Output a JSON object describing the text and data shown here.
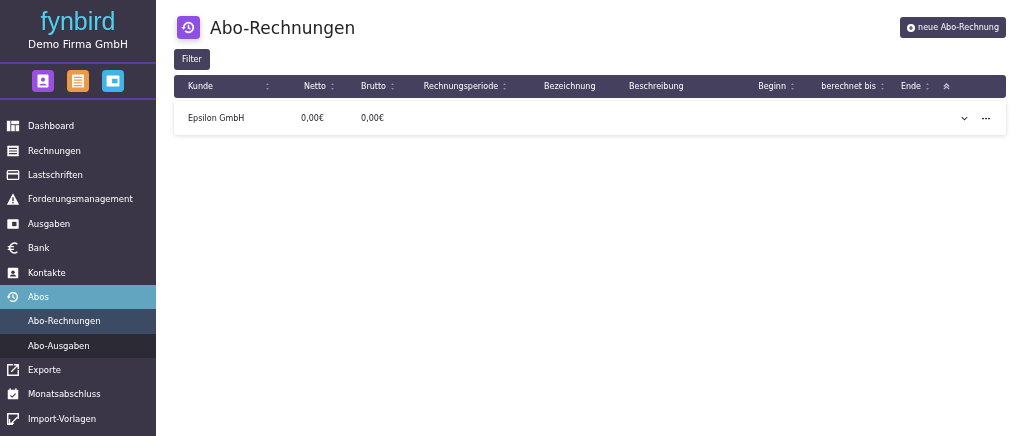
{
  "brand": {
    "logo": "fynbird",
    "company": "Demo Firma GmbH"
  },
  "sidebar": {
    "items": [
      {
        "label": "Dashboard",
        "selected": false
      },
      {
        "label": "Rechnungen",
        "selected": false
      },
      {
        "label": "Lastschriften",
        "selected": false
      },
      {
        "label": "Forderungsmanagement",
        "selected": false
      },
      {
        "label": "Ausgaben",
        "selected": false
      },
      {
        "label": "Bank",
        "selected": false
      },
      {
        "label": "Kontakte",
        "selected": false
      },
      {
        "label": "Abos",
        "selected": true,
        "expanded": true,
        "children": [
          {
            "label": "Abo-Rechnungen",
            "selected": true
          },
          {
            "label": "Abo-Ausgaben",
            "selected": false
          }
        ]
      },
      {
        "label": "Exporte",
        "selected": false
      },
      {
        "label": "Monatsabschluss",
        "selected": false
      },
      {
        "label": "Import-Vorlagen",
        "selected": false
      }
    ]
  },
  "page": {
    "title": "Abo-Rechnungen",
    "new_button": "neue Abo-Rechnung",
    "filter_button": "Filter"
  },
  "table": {
    "columns": [
      {
        "label": "Kunde",
        "sortable": true
      },
      {
        "label": "Netto",
        "sortable": true
      },
      {
        "label": "Brutto",
        "sortable": true
      },
      {
        "label": "Rechnungsperiode",
        "sortable": true
      },
      {
        "label": "Bezeichnung",
        "sortable": false
      },
      {
        "label": "Beschreibung",
        "sortable": false
      },
      {
        "label": "Beginn",
        "sortable": true
      },
      {
        "label": "berechnet bis",
        "sortable": true
      },
      {
        "label": "Ende",
        "sortable": true
      }
    ],
    "rows": [
      {
        "cells": [
          "Epsilon GmbH",
          "0,00€",
          "0,00€",
          "",
          "",
          "",
          "",
          "",
          ""
        ]
      }
    ]
  }
}
